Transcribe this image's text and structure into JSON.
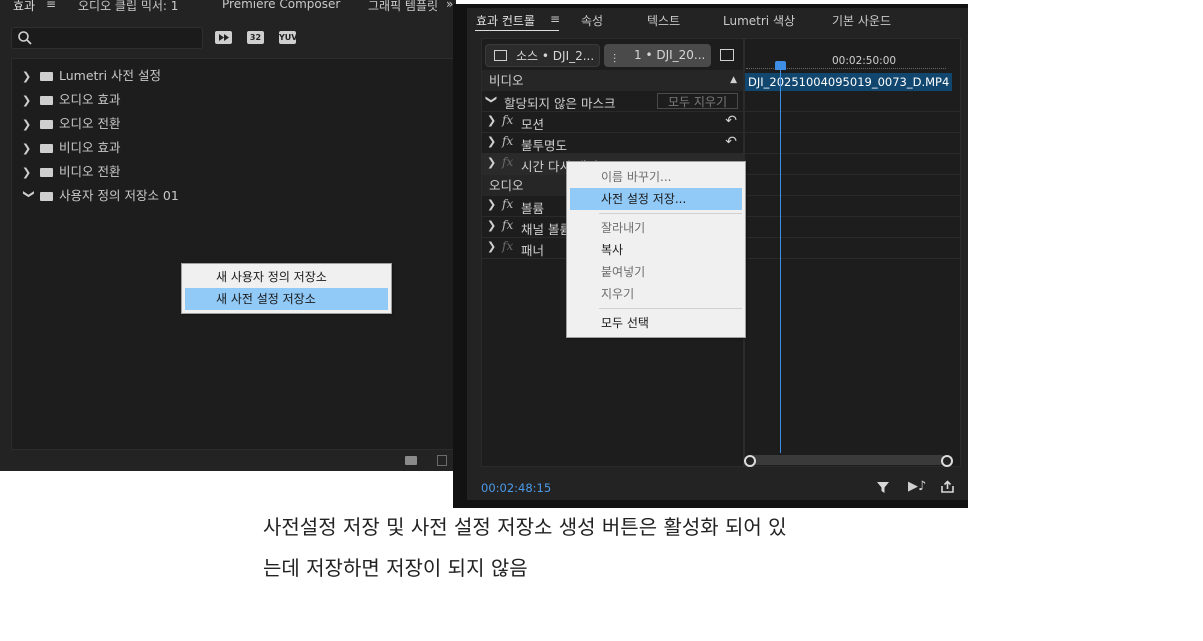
{
  "left_panel": {
    "tabs": [
      "효과",
      "오디오 클립 믹서: 1",
      "Premiere Composer",
      "그래픽 템플릿"
    ],
    "overflow_glyph": "»",
    "badges": [
      "32",
      "YUV"
    ],
    "tree": [
      {
        "label": "Lumetri 사전 설정",
        "expanded": false
      },
      {
        "label": "오디오 효과",
        "expanded": false
      },
      {
        "label": "오디오 전환",
        "expanded": false
      },
      {
        "label": "비디오 효과",
        "expanded": false
      },
      {
        "label": "비디오 전환",
        "expanded": false
      },
      {
        "label": "사용자 정의 저장소 01",
        "expanded": true
      }
    ],
    "context_menu": {
      "items": [
        {
          "label": "새 사용자 정의 저장소",
          "highlighted": false
        },
        {
          "label": "새 사전 설정 저장소",
          "highlighted": true
        }
      ]
    }
  },
  "right_panel": {
    "tabs": [
      "효과 컨트롤",
      "속성",
      "텍스트",
      "Lumetri 색상",
      "기본 사운드"
    ],
    "source_chip": "소스 • DJI_2...",
    "sequence_chip": "1 • DJI_20...",
    "ruler_time": "00:02:50:00",
    "clip_name": "DJI_20251004095019_0073_D.MP4",
    "video_header": "비디오",
    "mask_row": {
      "label": "할당되지 않은 마스크",
      "button": "모두 지우기"
    },
    "video_effects": [
      {
        "label": "모션",
        "reset": true
      },
      {
        "label": "불투명도",
        "reset": true
      },
      {
        "label": "시간 다시 매핑",
        "reset": false
      }
    ],
    "audio_header": "오디오",
    "audio_effects": [
      {
        "label": "볼륨"
      },
      {
        "label": "채널 볼륨"
      },
      {
        "label": "패너"
      }
    ],
    "context_menu": {
      "items": [
        {
          "label": "이름 바꾸기...",
          "state": "disabled"
        },
        {
          "label": "사전 설정 저장...",
          "state": "highlighted"
        },
        {
          "label": "잘라내기",
          "state": "disabled"
        },
        {
          "label": "복사",
          "state": "enabled"
        },
        {
          "label": "붙여넣기",
          "state": "disabled"
        },
        {
          "label": "지우기",
          "state": "disabled"
        },
        {
          "label": "모두 선택",
          "state": "enabled"
        }
      ]
    },
    "timecode": "00:02:48:15"
  },
  "caption": {
    "line1": "사전설정 저장 및 사전 설정 저장소 생성 버튼은 활성화 되어 있",
    "line2": "는데 저장하면 저장이 되지 않음"
  },
  "colors": {
    "panel_bg": "#232323",
    "menu_highlight": "#91c9f7",
    "clip_bar": "#11466f",
    "playhead": "#3f8fe0",
    "timecode": "#4c9ae8"
  }
}
